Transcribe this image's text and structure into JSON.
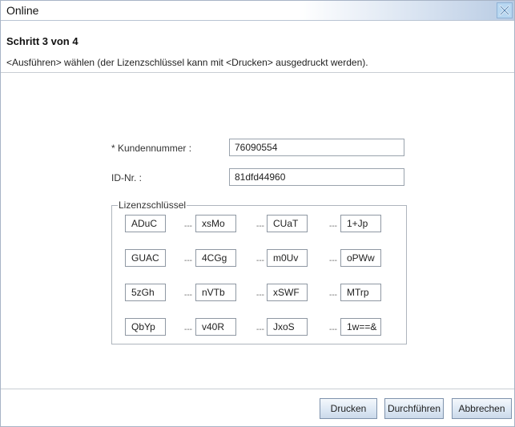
{
  "window": {
    "title": "Online"
  },
  "header": {
    "step": "Schritt 3 von 4",
    "instruction": "<Ausführen> wählen (der Lizenzschlüssel kann mit <Drucken> ausgedruckt werden)."
  },
  "form": {
    "customer_label": "* Kundennummer :",
    "customer_value": "76090554",
    "id_label": "ID-Nr. :",
    "id_value": "81dfd44960"
  },
  "license": {
    "legend": "Lizenzschlüssel",
    "separator": "---",
    "rows": [
      [
        "ADuC",
        "xsMo",
        "CUaT",
        "1+Jp"
      ],
      [
        "GUAC",
        "4CGg",
        "m0Uv",
        "oPWw"
      ],
      [
        "5zGh",
        "nVTb",
        "xSWF",
        "MTrp"
      ],
      [
        "QbYp",
        "v40R",
        "JxoS",
        "1w==&"
      ]
    ]
  },
  "footer": {
    "print_label": "Drucken",
    "execute_label": "Durchführen",
    "cancel_label": "Abbrechen"
  }
}
